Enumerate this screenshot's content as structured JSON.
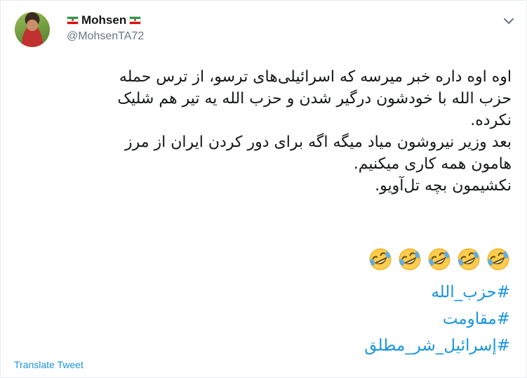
{
  "author": {
    "display_name": "Mohsen",
    "handle": "@MohsenTA72",
    "flag_icon": "iran-flag-icon",
    "colors": {
      "flag_green": "#239f40",
      "flag_red": "#da0000"
    }
  },
  "tweet": {
    "lines": [
      "اوه اوه داره خبر میرسه که اسرائیلی‌های ترسو، از ترس حمله",
      "حزب الله با خودشون درگیر شدن و حزب الله یه تیر هم شلیک",
      "نکرده.",
      "بعد وزیر نیروشون میاد میگه اگه برای دور کردن ایران از مرز",
      "هامون همه کاری میکنیم.",
      "نکشیمون بچه تل‌آویو."
    ],
    "emoji": [
      "🤣",
      "🤣",
      "🤣",
      "🤣",
      "🤣"
    ],
    "emoji_icon": "rolling-on-floor-laughing-icon",
    "hashtags": [
      "#حزب_الله",
      "#مقاومت",
      "#إسرائيل_شر_مطلق"
    ]
  },
  "actions": {
    "translate_label": "Translate Tweet",
    "more_icon": "chevron-down-icon"
  },
  "colors": {
    "link": "#1b95e0",
    "text": "#14171a",
    "secondary": "#657786"
  }
}
